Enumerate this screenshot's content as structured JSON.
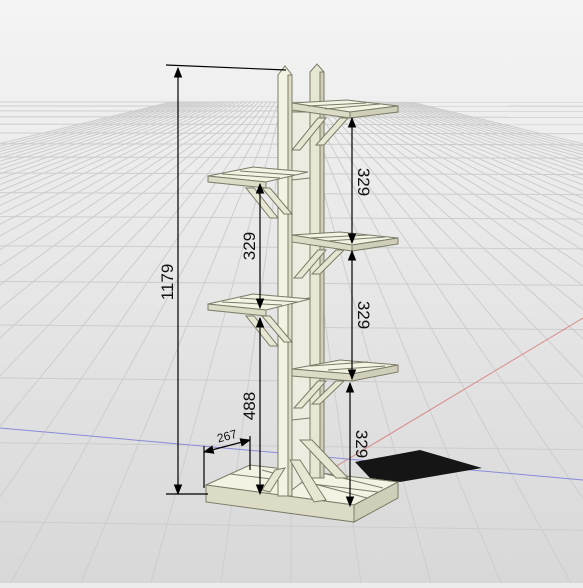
{
  "dimensions": {
    "total_height": "1179",
    "base_to_left_lower_shelf": "488",
    "left_shelf_spacing": "329",
    "base_depth": "267",
    "right_upper_spacing": "329",
    "right_middle_spacing": "329",
    "right_lower_spacing": "329"
  },
  "colors": {
    "wood_light": "#f3f3e3",
    "wood_mid": "#e6e6d2",
    "wood_shadow": "#cfcfb9",
    "edge": "#7b7b68",
    "dimension_line": "#000000",
    "grid_line": "#cfcfcf",
    "axis_red": "#d98a8a",
    "axis_blue": "#8a8ad9"
  }
}
